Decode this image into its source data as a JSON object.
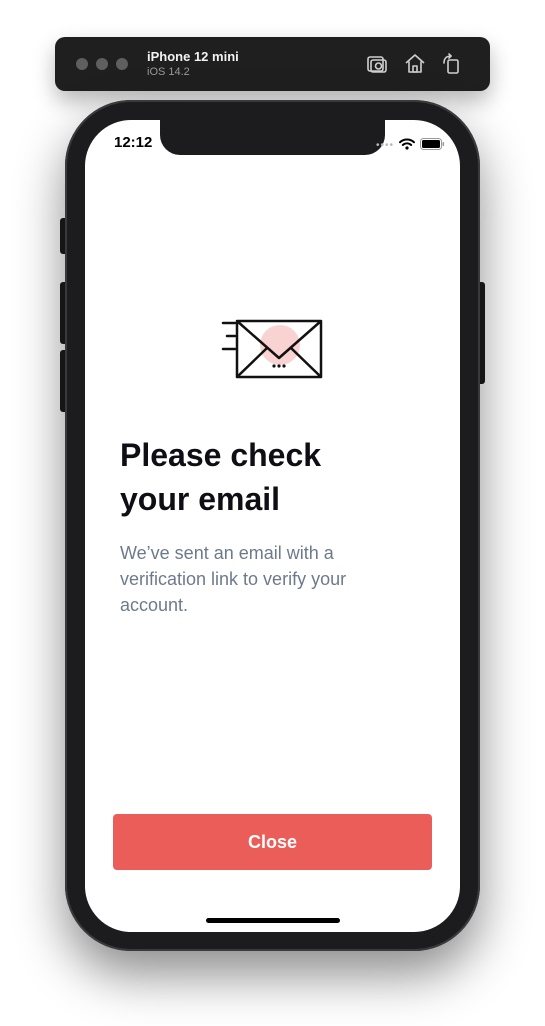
{
  "simulator": {
    "device_name": "iPhone 12 mini",
    "os_version": "iOS 14.2",
    "icons": [
      "screenshot-icon",
      "home-icon",
      "rotate-icon"
    ]
  },
  "status_bar": {
    "time": "12:12",
    "icons": [
      "signal-icon",
      "wifi-icon",
      "battery-icon"
    ]
  },
  "illustration": {
    "icon": "mail-sent-icon",
    "accent_color": "#f8d3d1"
  },
  "content": {
    "title_line_1": "Please check",
    "title_line_2": "your email",
    "body": "We’ve sent an email with a verification link to verify your account."
  },
  "actions": {
    "close_label": "Close",
    "close_color": "#eb5d58"
  }
}
